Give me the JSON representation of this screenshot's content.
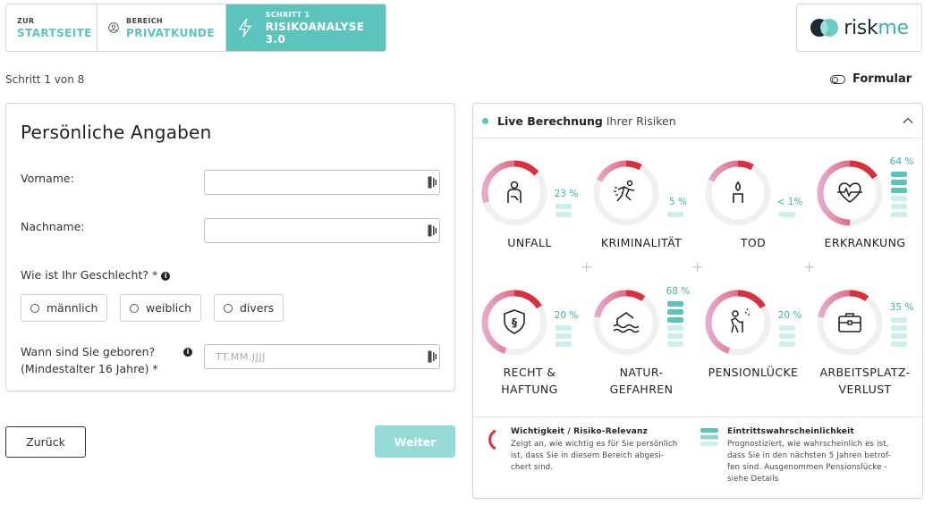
{
  "nav": {
    "home": {
      "small": "ZUR",
      "big": "STARTSEITE"
    },
    "area": {
      "small": "BEREICH",
      "big": "PRIVATKUNDE",
      "icon": "user-circle-icon"
    },
    "step": {
      "small": "SCHRITT 1",
      "big": "RISIKOANALYSE 3.0",
      "icon": "lightning-icon"
    }
  },
  "logo": {
    "text_main": "risk",
    "text_accent": "me"
  },
  "progress": {
    "label": "Schritt 1 von 8"
  },
  "formular": {
    "label": "Formular",
    "icon": "toggle-icon"
  },
  "form": {
    "title": "Persönliche Angaben",
    "first_name_label": "Vorname:",
    "first_name_value": "",
    "last_name_label": "Nachname:",
    "last_name_value": "",
    "gender_label": "Wie ist Ihr Geschlecht? *",
    "gender_options": [
      "männlich",
      "weiblich",
      "divers"
    ],
    "birth_label_1": "Wann sind Sie geboren?",
    "birth_label_2": "(Mindestalter 16 Jahre) *",
    "birth_placeholder": "TT.MM.JJJJ"
  },
  "buttons": {
    "back": "Zurück",
    "next": "Weiter"
  },
  "risk_panel": {
    "title_bold": "Live Berechnung",
    "title_rest": "Ihrer Risiken",
    "risks": [
      {
        "name_1": "UNFALL",
        "name_2": "",
        "percent": "23 %",
        "importance": 0.3,
        "bars_on": 0,
        "bars": 2,
        "icon": "accident-icon"
      },
      {
        "name_1": "KRIMINALITÄT",
        "name_2": "",
        "percent": "5 %",
        "importance": 0.18,
        "bars_on": 0,
        "bars": 1,
        "icon": "crime-icon"
      },
      {
        "name_1": "TOD",
        "name_2": "",
        "percent": "< 1%",
        "importance": 0.18,
        "bars_on": 0,
        "bars": 1,
        "icon": "death-icon"
      },
      {
        "name_1": "ERKRANKUNG",
        "name_2": "",
        "percent": "64 %",
        "importance": 0.5,
        "bars_on": 3,
        "bars": 6,
        "icon": "heartbeat-icon"
      },
      {
        "name_1": "RECHT &",
        "name_2": "HAFTUNG",
        "percent": "20 %",
        "importance": 0.45,
        "bars_on": 0,
        "bars": 3,
        "icon": "law-icon"
      },
      {
        "name_1": "NATUR-",
        "name_2": "GEFAHREN",
        "percent": "68 %",
        "importance": 0.22,
        "bars_on": 3,
        "bars": 6,
        "icon": "flood-icon"
      },
      {
        "name_1": "PENSIONLÜCKE",
        "name_2": "",
        "percent": "20 %",
        "importance": 0.45,
        "bars_on": 0,
        "bars": 3,
        "icon": "elderly-icon"
      },
      {
        "name_1": "ARBEITSPLATZ-",
        "name_2": "VERLUST",
        "percent": "35 %",
        "importance": 0.22,
        "bars_on": 0,
        "bars": 4,
        "icon": "briefcase-icon"
      }
    ],
    "legend": {
      "importance_title": "Wichtigkeit / Risiko-Relevanz",
      "importance_lines": [
        "Zeigt an, wie wichtig es für Sie persönlich",
        "ist, dass Sie in diesem Bereich abgesi-",
        "chert sind."
      ],
      "probability_title": "Eintrittswahrscheinlichkeit",
      "probability_lines": [
        "Prognostiziert, wie wahrscheinlich es ist,",
        "dass Sie in den nächsten 5 Jahren betrof-",
        "fen sind. Ausgenommen Pensionslücke -",
        "siehe Details"
      ]
    }
  },
  "colors": {
    "teal": "#5cc3bd",
    "teal_light": "#cdeeed",
    "red": "#d9303e",
    "pink": "#e7a9cf",
    "ring_bg": "#f0f0f0"
  }
}
